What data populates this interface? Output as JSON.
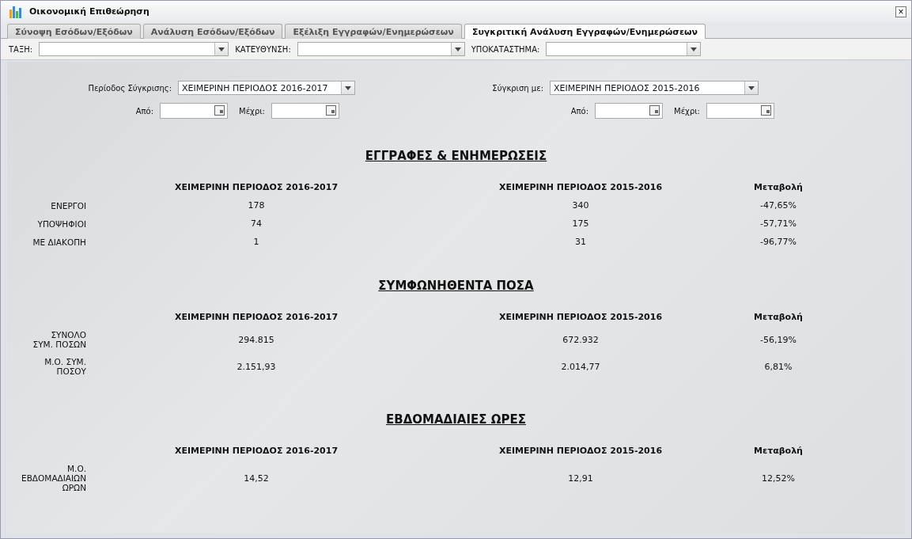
{
  "window": {
    "title": "Οικονομική Επιθεώρηση",
    "close": "×"
  },
  "tabs": [
    {
      "label": "Σύνοψη Εσόδων/Εξόδων",
      "selected": false
    },
    {
      "label": "Ανάλυση Εσόδων/Εξόδων",
      "selected": false
    },
    {
      "label": "Εξέλιξη Εγγραφών/Ενημερώσεων",
      "selected": false
    },
    {
      "label": "Συγκριτική Ανάλυση Εγγραφών/Ενημερώσεων",
      "selected": true
    }
  ],
  "filters": [
    {
      "label": "ΤΑΞΗ:"
    },
    {
      "label": "ΚΑΤΕΥΘΥΝΣΗ:"
    },
    {
      "label": "ΥΠΟΚΑΤΑΣΤΗΜΑ:"
    }
  ],
  "comparison": [
    {
      "label": "Περίοδος Σύγκρισης:",
      "value": "ΧΕΙΜΕΡΙΝΗ ΠΕΡΙΟΔΟΣ 2016-2017",
      "from_label": "Από:",
      "to_label": "Μέχρι:"
    },
    {
      "label": "Σύγκριση με:",
      "value": "ΧΕΙΜΕΡΙΝΗ ΠΕΡΙΟΔΟΣ 2015-2016",
      "from_label": "Από:",
      "to_label": "Μέχρι:"
    }
  ],
  "sections": [
    {
      "title": "ΕΓΓΡΑΦΕΣ & ΕΝΗΜΕΡΩΣΕΙΣ",
      "columns": [
        "ΧΕΙΜΕΡΙΝΗ ΠΕΡΙΟΔΟΣ 2016-2017",
        "ΧΕΙΜΕΡΙΝΗ ΠΕΡΙΟΔΟΣ 2015-2016",
        "Μεταβολή"
      ],
      "rows": [
        {
          "label": "ΕΝΕΡΓΟΙ",
          "values": [
            "178",
            "340",
            "-47,65%"
          ]
        },
        {
          "label": "ΥΠΟΨΗΦΙΟΙ",
          "values": [
            "74",
            "175",
            "-57,71%"
          ]
        },
        {
          "label": "ΜΕ ΔΙΑΚΟΠΗ",
          "values": [
            "1",
            "31",
            "-96,77%"
          ]
        }
      ]
    },
    {
      "title": "ΣΥΜΦΩΝΗΘΕΝΤΑ ΠΟΣΑ",
      "columns": [
        "ΧΕΙΜΕΡΙΝΗ ΠΕΡΙΟΔΟΣ 2016-2017",
        "ΧΕΙΜΕΡΙΝΗ ΠΕΡΙΟΔΟΣ 2015-2016",
        "Μεταβολή"
      ],
      "rows": [
        {
          "label": "ΣΥΝΟΛΟ\nΣΥΜ. ΠΟΣΩΝ",
          "values": [
            "294.815",
            "672.932",
            "-56,19%"
          ]
        },
        {
          "label": "Μ.Ο. ΣΥΜ.\nΠΟΣΟΥ",
          "values": [
            "2.151,93",
            "2.014,77",
            "6,81%"
          ]
        }
      ]
    },
    {
      "title": "ΕΒΔΟΜΑΔΙΑΙΕΣ ΩΡΕΣ",
      "columns": [
        "ΧΕΙΜΕΡΙΝΗ ΠΕΡΙΟΔΟΣ 2016-2017",
        "ΧΕΙΜΕΡΙΝΗ ΠΕΡΙΟΔΟΣ 2015-2016",
        "Μεταβολή"
      ],
      "rows": [
        {
          "label": "Μ.Ο.\nΕΒΔΟΜΑΔΙΑΙΩΝ\nΩΡΩΝ",
          "values": [
            "14,52",
            "12,91",
            "12,52%"
          ]
        }
      ]
    }
  ]
}
